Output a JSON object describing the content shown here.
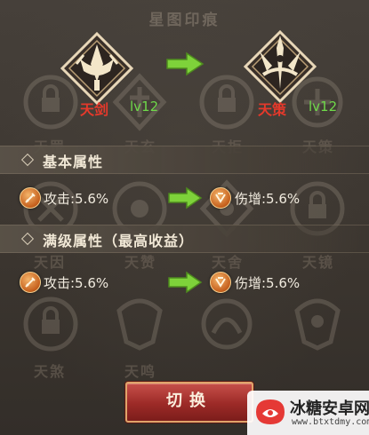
{
  "title": "星图印痕",
  "left_seal": {
    "name": "天剑",
    "level": "lv12"
  },
  "right_seal": {
    "name": "天策",
    "level": "lv12"
  },
  "background_labels": [
    "天罡",
    "天玄",
    "天拒",
    "天策",
    "天因",
    "天赞",
    "天舍",
    "天镜",
    "天煞",
    "天鸣"
  ],
  "base_section": {
    "label": "基本属性",
    "from_stat": "攻击:5.6%",
    "to_stat": "伤增:5.6%"
  },
  "max_section": {
    "label": "满级属性（最高收益）",
    "from_stat": "攻击:5.6%",
    "to_stat": "伤增:5.6%"
  },
  "switch_button": "切换",
  "watermark": {
    "title": "冰糖安卓网",
    "url": "www.btxtdmy.com"
  },
  "colors": {
    "name_red": "#e5392b",
    "level_green": "#6fd94a",
    "arrow_green": "#7ed23a",
    "button_red": "#9c2a27"
  }
}
